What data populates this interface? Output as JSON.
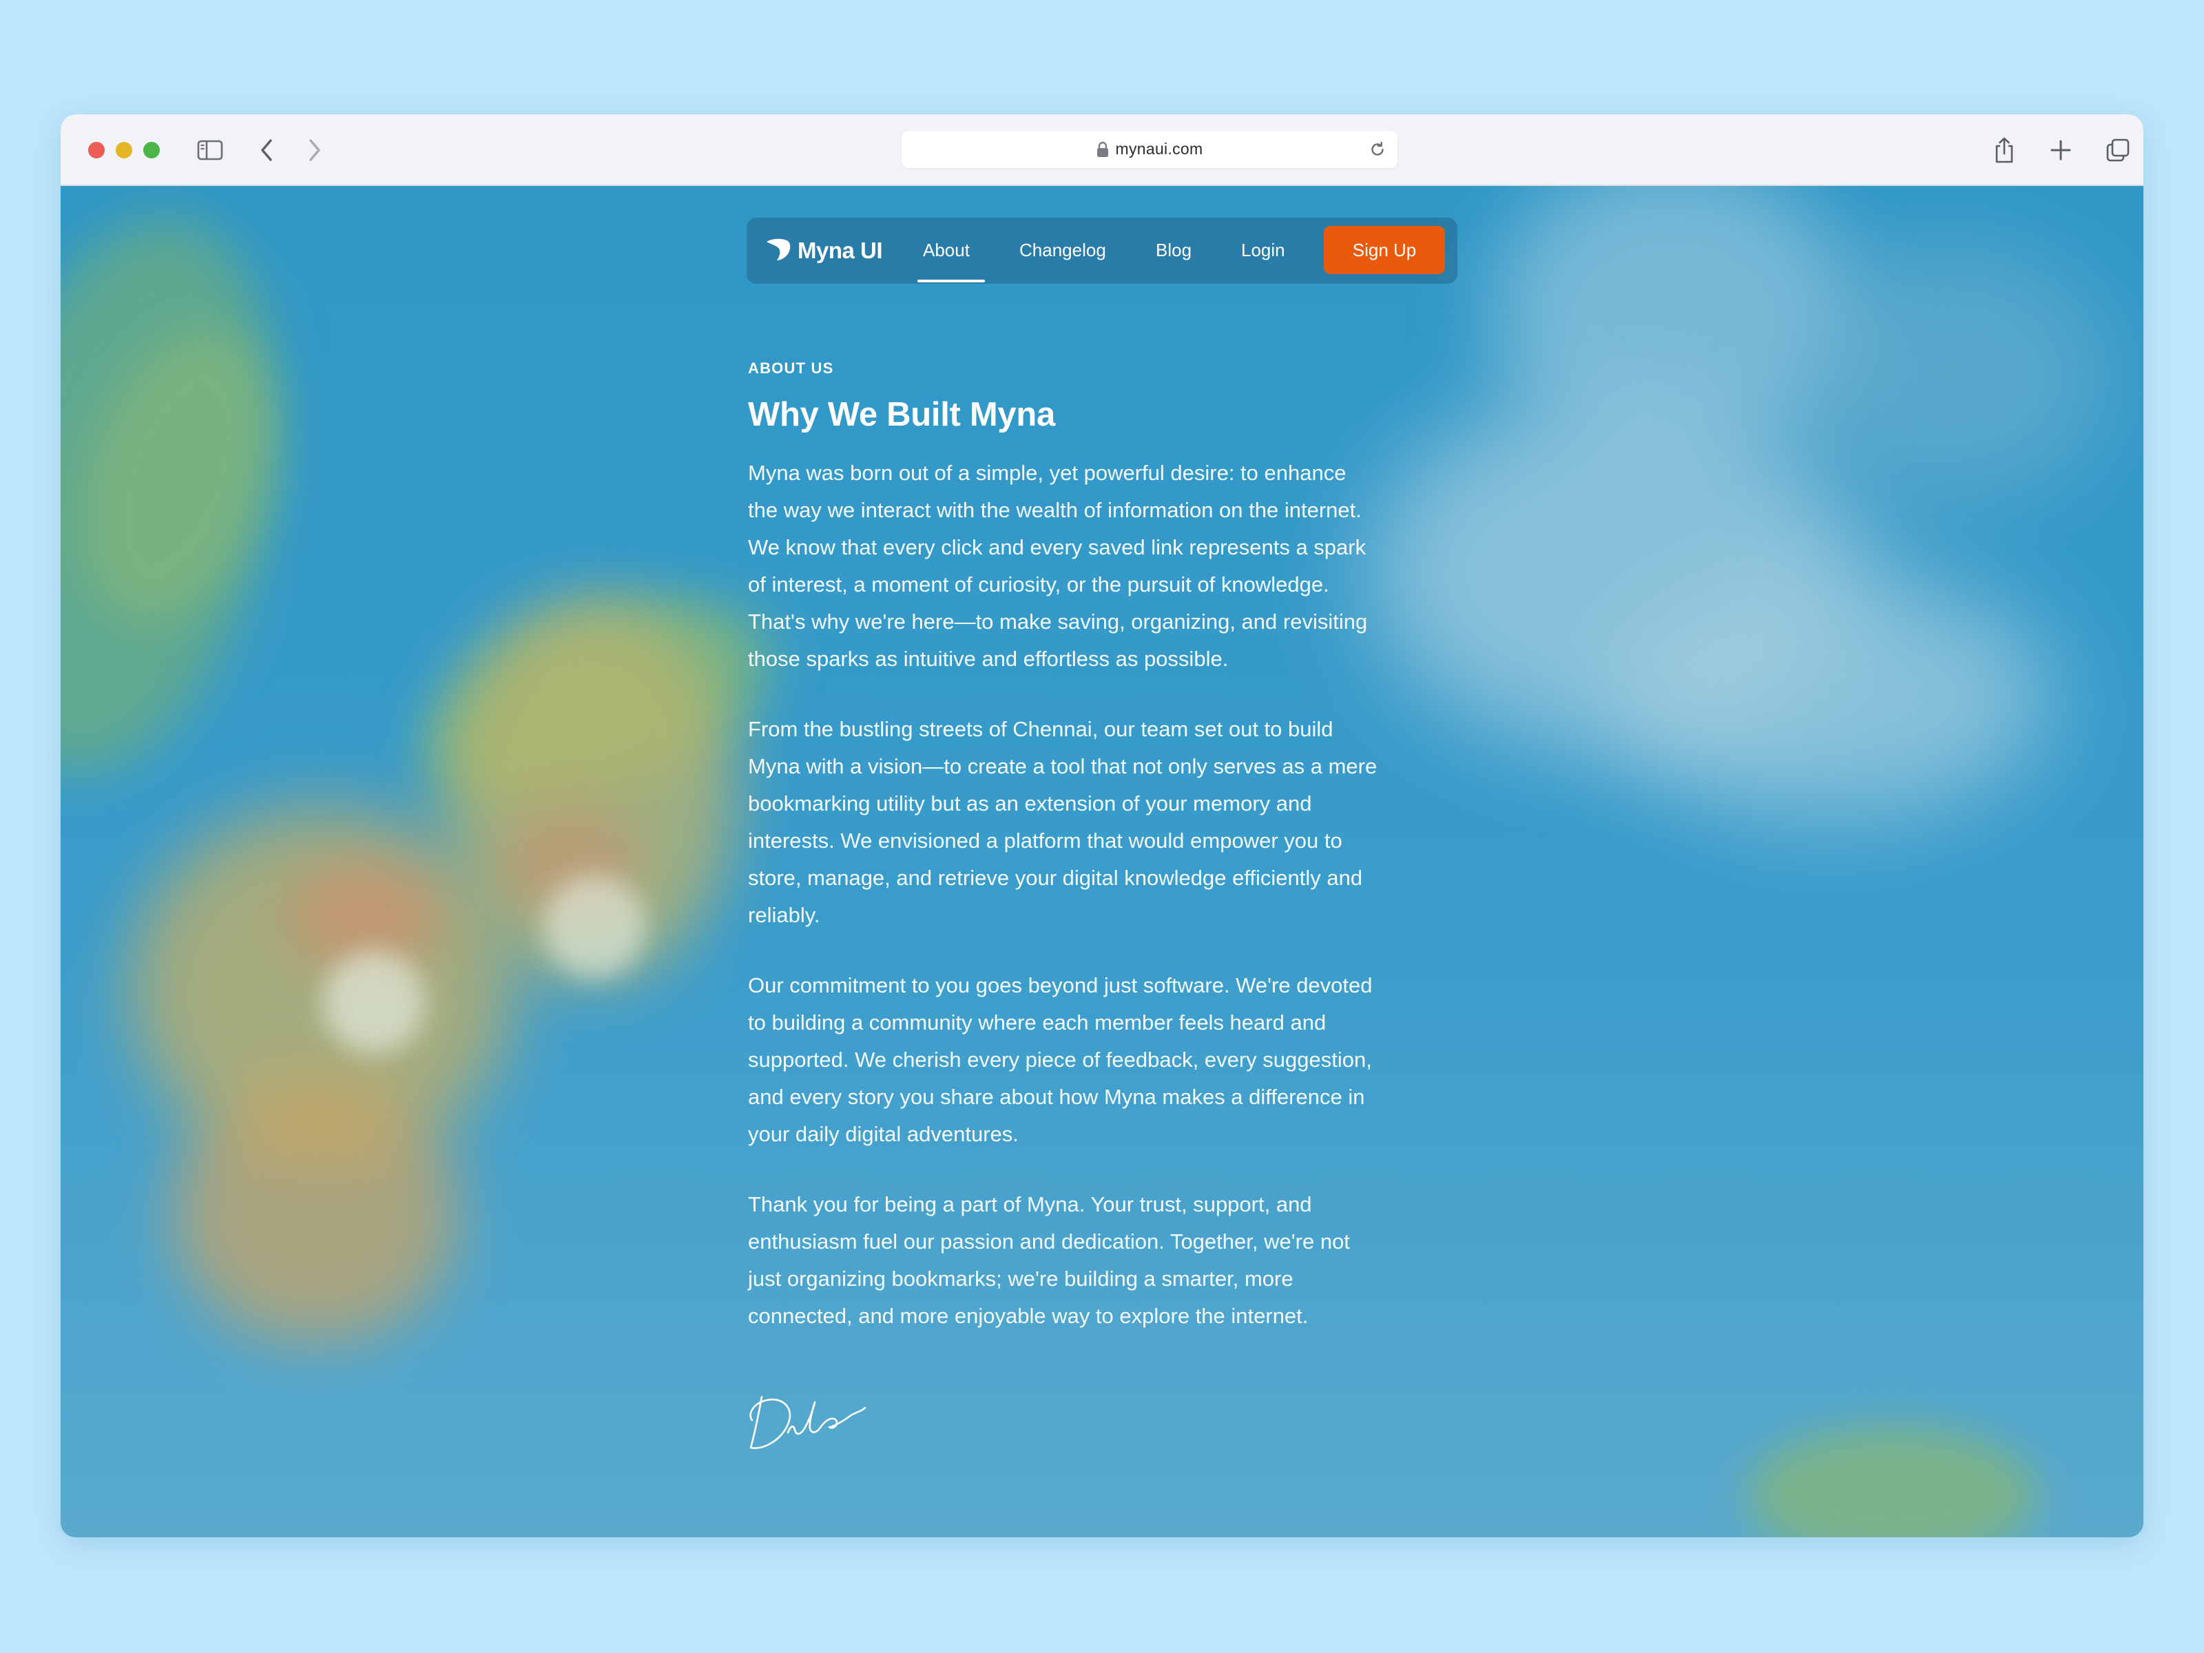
{
  "browser": {
    "url": "mynaui.com"
  },
  "nav": {
    "brand": "Myna UI",
    "links": [
      "About",
      "Changelog",
      "Blog",
      "Login"
    ],
    "active": "About",
    "signup_label": "Sign Up",
    "accent_color": "#ea5a0c"
  },
  "content": {
    "eyebrow": "ABOUT US",
    "title": "Why We Built Myna",
    "paragraphs": [
      [
        "Myna was born out of a simple, yet powerful desire: to enhance",
        "the way we interact with the wealth of information on the internet.",
        "We know that every click and every saved link represents a spark",
        "of interest, a moment of curiosity, or the pursuit of knowledge.",
        "That's why we're here—to make saving, organizing, and revisiting",
        "those sparks as intuitive and effortless as possible."
      ],
      [
        "From the bustling streets of Chennai, our team set out to build",
        "Myna with a vision—to create a tool that not only serves as a mere",
        "bookmarking utility but as an extension of your memory and",
        "interests. We envisioned a platform that would empower you to",
        "store, manage, and retrieve your digital knowledge efficiently and",
        "reliably."
      ],
      [
        "Our commitment to you goes beyond just software. We're devoted",
        "to building a community where each member feels heard and",
        "supported. We cherish every piece of feedback, every suggestion,",
        "and every story you share about how Myna makes a difference in",
        "your daily digital adventures."
      ],
      [
        "Thank you for being a part of Myna. Your trust, support, and",
        "enthusiasm fuel our passion and dedication. Together, we're not",
        "just organizing bookmarks; we're building a smarter, more",
        "connected, and more enjoyable way to explore the internet."
      ]
    ]
  },
  "icons": {
    "toolbar_left": [
      "sidebar-icon",
      "back-icon",
      "forward-icon"
    ],
    "toolbar_right": [
      "share-icon",
      "new-tab-icon",
      "tabs-overview-icon"
    ],
    "address": [
      "lock-icon",
      "reload-icon"
    ]
  }
}
